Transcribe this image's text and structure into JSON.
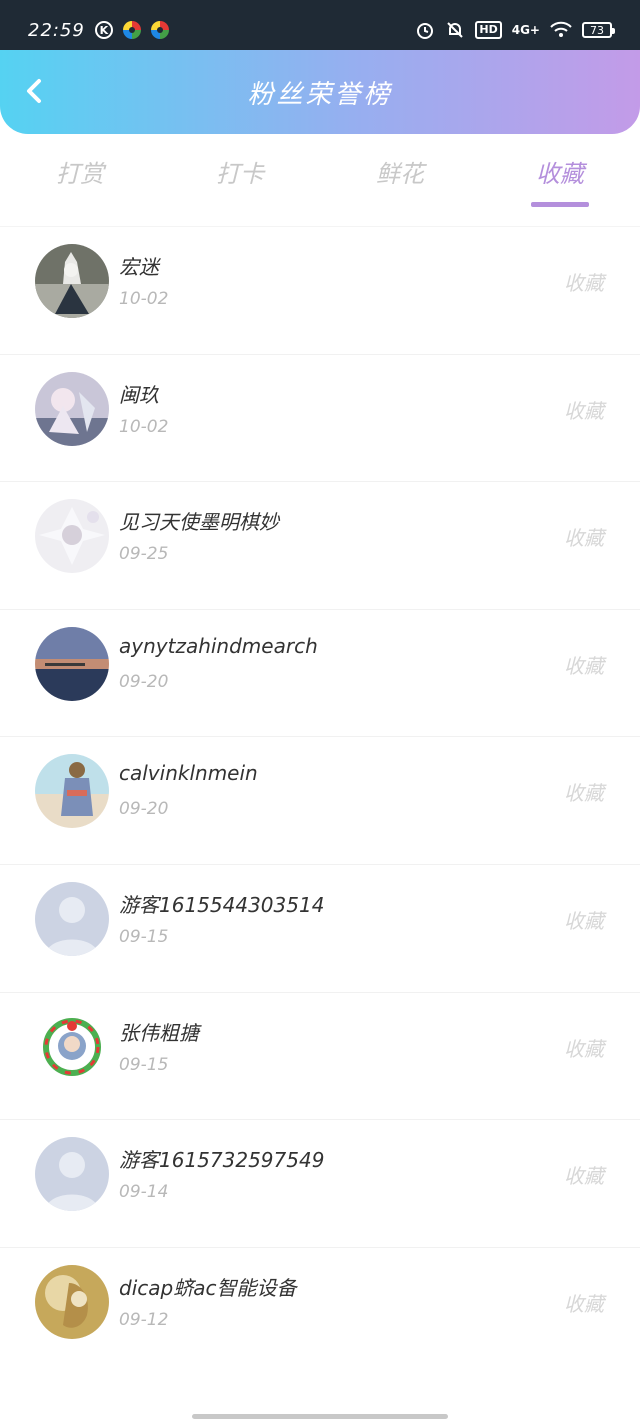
{
  "status_bar": {
    "time": "22:59",
    "k_icon_label": "K",
    "hd_label": "HD",
    "network_label": "4G+",
    "battery": "73",
    "icons": [
      "k-circle-icon",
      "app-icon",
      "app-icon",
      "alarm-icon",
      "mute-bell-icon",
      "hd-icon",
      "signal-icon",
      "wifi-icon",
      "battery-icon"
    ]
  },
  "header": {
    "title": "粉丝荣誉榜",
    "back_icon": "chevron-left-icon",
    "gradient": [
      "#55d2f2",
      "#c39be8"
    ]
  },
  "tabs": [
    {
      "label": "打赏",
      "active": false
    },
    {
      "label": "打卡",
      "active": false
    },
    {
      "label": "鲜花",
      "active": false
    },
    {
      "label": "收藏",
      "active": true
    }
  ],
  "accent_color": "#b48fdc",
  "list": [
    {
      "name": "宏迷",
      "date": "10-02",
      "action": "收藏",
      "avatar": "photo-avatar"
    },
    {
      "name": "闽玖",
      "date": "10-02",
      "action": "收藏",
      "avatar": "photo-avatar"
    },
    {
      "name": "见习天使墨明棋妙",
      "date": "09-25",
      "action": "收藏",
      "avatar": "photo-avatar"
    },
    {
      "name": "aynytzahindmearch",
      "date": "09-20",
      "action": "收藏",
      "avatar": "photo-avatar"
    },
    {
      "name": "calvinklnmein",
      "date": "09-20",
      "action": "收藏",
      "avatar": "photo-avatar"
    },
    {
      "name": "游客1615544303514",
      "date": "09-15",
      "action": "收藏",
      "avatar": "default-user-avatar"
    },
    {
      "name": "张伟粗搪",
      "date": "09-15",
      "action": "收藏",
      "avatar": "photo-avatar"
    },
    {
      "name": "游客1615732597549",
      "date": "09-14",
      "action": "收藏",
      "avatar": "default-user-avatar"
    },
    {
      "name": "dicap蛴ac智能设备",
      "date": "09-12",
      "action": "收藏",
      "avatar": "photo-avatar"
    }
  ]
}
